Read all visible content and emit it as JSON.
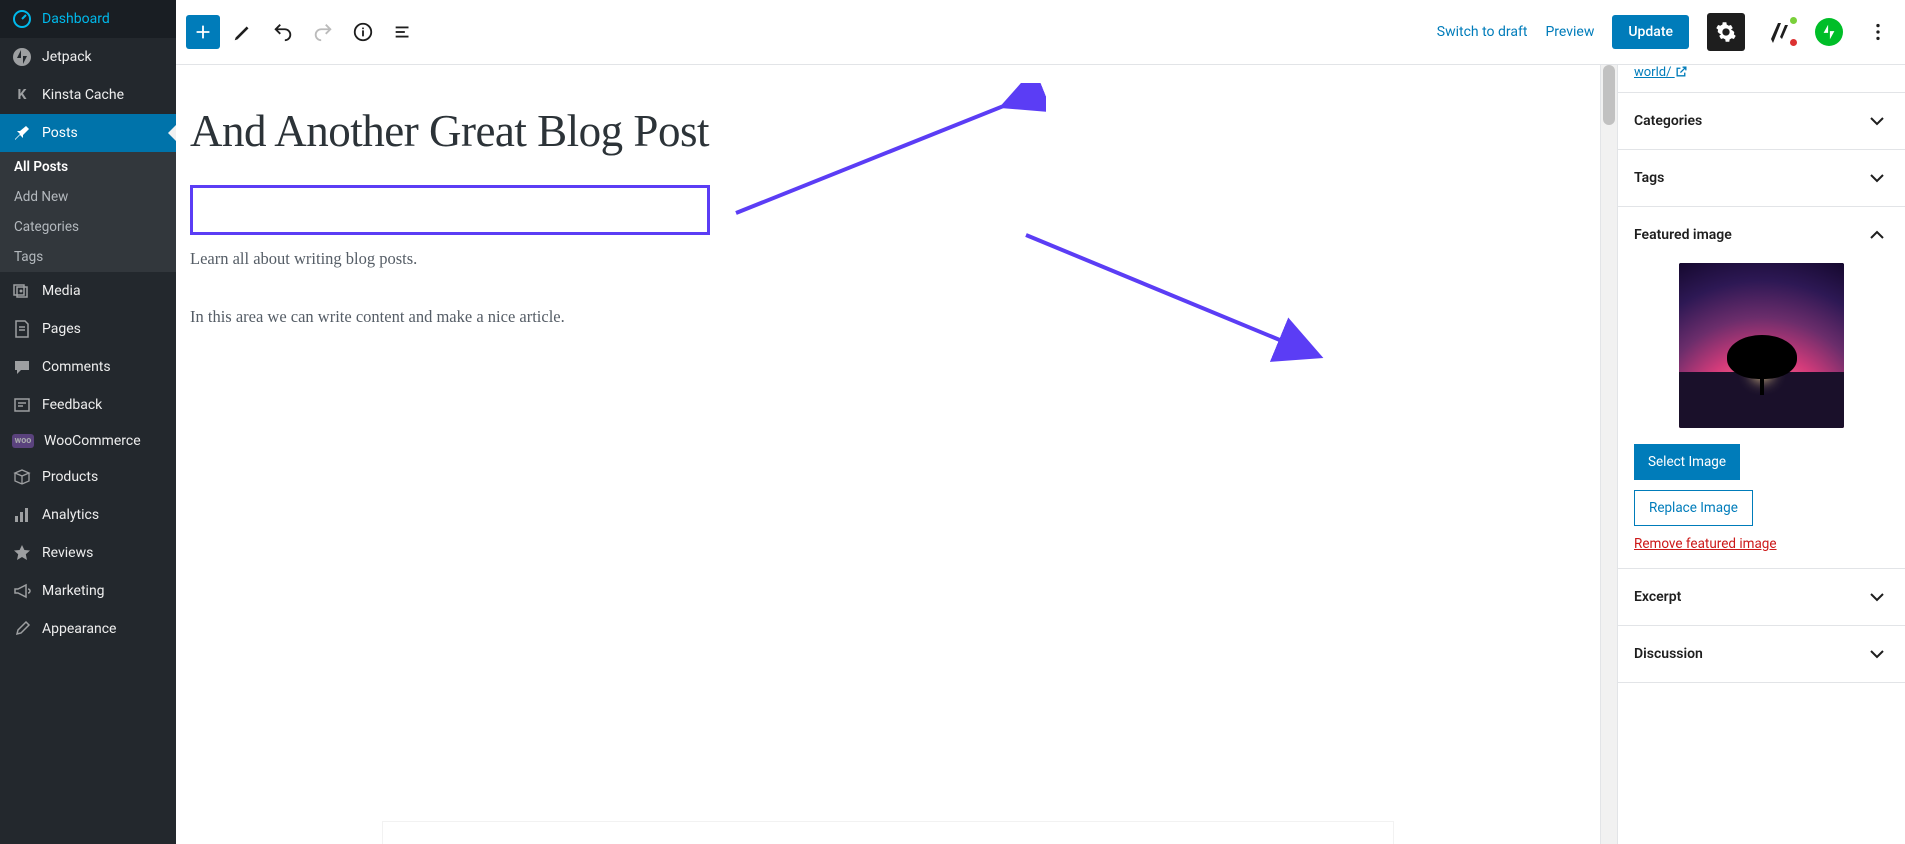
{
  "sidebar": {
    "items": [
      {
        "label": "Dashboard",
        "icon": "dashboard"
      },
      {
        "label": "Jetpack",
        "icon": "jetpack"
      },
      {
        "label": "Kinsta Cache",
        "icon": "kinsta"
      },
      {
        "label": "Posts",
        "icon": "pin",
        "active": true
      },
      {
        "label": "Media",
        "icon": "media"
      },
      {
        "label": "Pages",
        "icon": "pages"
      },
      {
        "label": "Comments",
        "icon": "comments"
      },
      {
        "label": "Feedback",
        "icon": "feedback"
      },
      {
        "label": "WooCommerce",
        "icon": "woo"
      },
      {
        "label": "Products",
        "icon": "products"
      },
      {
        "label": "Analytics",
        "icon": "analytics"
      },
      {
        "label": "Reviews",
        "icon": "star"
      },
      {
        "label": "Marketing",
        "icon": "megaphone"
      },
      {
        "label": "Appearance",
        "icon": "brush"
      }
    ],
    "posts_sub": [
      {
        "label": "All Posts",
        "active": true
      },
      {
        "label": "Add New"
      },
      {
        "label": "Categories"
      },
      {
        "label": "Tags"
      }
    ]
  },
  "topbar": {
    "switch_draft": "Switch to draft",
    "preview": "Preview",
    "update": "Update"
  },
  "post": {
    "title": "And Another Great Blog Post",
    "subtitle": "Learn all about writing blog posts.",
    "body": "In this area we can write content and make a nice article."
  },
  "panel": {
    "permalink_tail": "world/",
    "categories": "Categories",
    "tags": "Tags",
    "featured": "Featured image",
    "select": "Select Image",
    "replace": "Replace Image",
    "remove": "Remove featured image",
    "excerpt": "Excerpt",
    "discussion": "Discussion"
  }
}
